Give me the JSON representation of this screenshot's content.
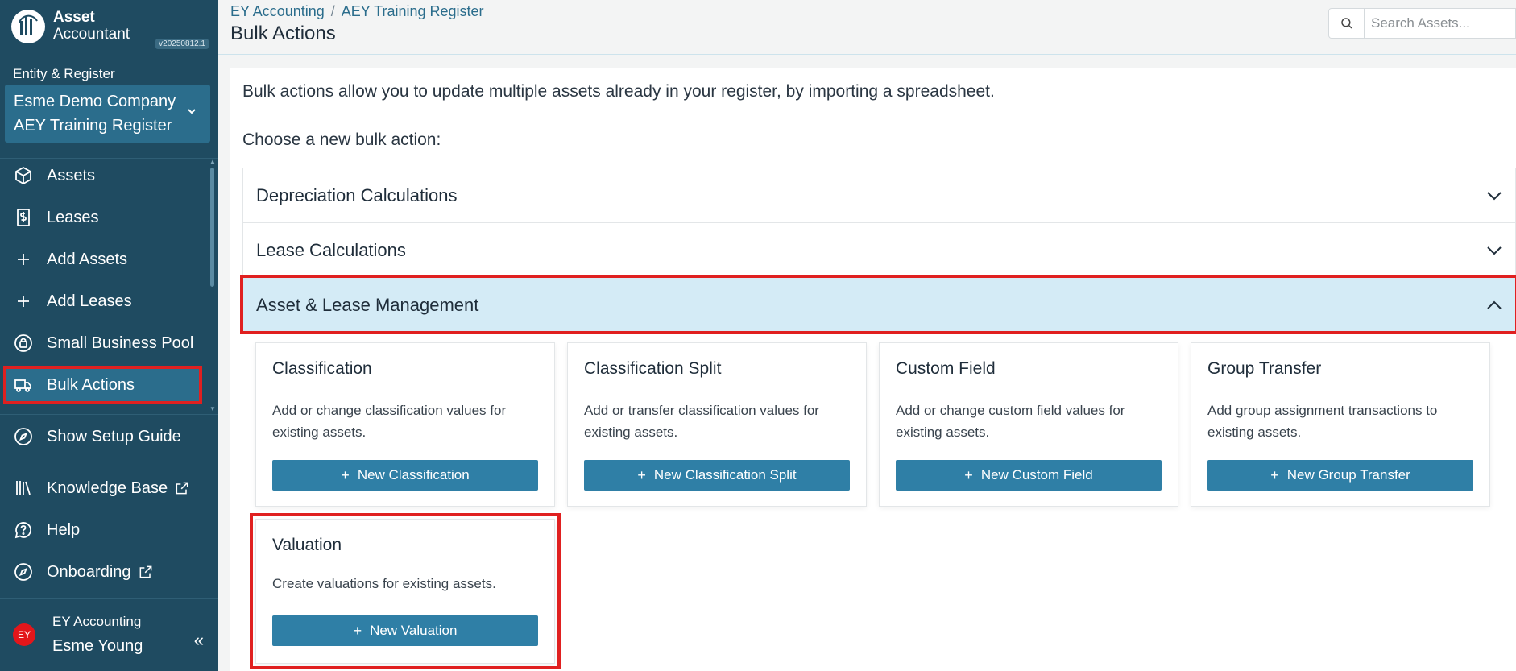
{
  "app": {
    "logo_title": "Asset",
    "logo_subtitle": "Accountant",
    "version": "v20250812.1"
  },
  "entity": {
    "label": "Entity & Register",
    "company": "Esme Demo Company",
    "register": "AEY Training Register"
  },
  "nav": {
    "assets": "Assets",
    "leases": "Leases",
    "add_assets": "Add Assets",
    "add_leases": "Add Leases",
    "small_business_pool": "Small Business Pool",
    "bulk_actions": "Bulk Actions",
    "show_setup_guide": "Show Setup Guide",
    "knowledge_base": "Knowledge Base",
    "help": "Help",
    "onboarding": "Onboarding"
  },
  "user": {
    "initials": "EY",
    "org": "EY Accounting",
    "name": "Esme Young",
    "collapse": "«"
  },
  "breadcrumb": {
    "first": "EY Accounting",
    "separator": "/",
    "second": "AEY Training Register"
  },
  "page": {
    "title": "Bulk Actions",
    "intro": "Bulk actions allow you to update multiple assets already in your register, by importing a spreadsheet.",
    "choose": "Choose a new bulk action:"
  },
  "search": {
    "placeholder": "Search Assets..."
  },
  "accordion": [
    {
      "label": "Depreciation Calculations",
      "expanded": false
    },
    {
      "label": "Lease Calculations",
      "expanded": false
    },
    {
      "label": "Asset & Lease Management",
      "expanded": true
    }
  ],
  "cards": [
    {
      "title": "Classification",
      "description": "Add or change classification values for existing assets.",
      "button": "New Classification"
    },
    {
      "title": "Classification Split",
      "description": "Add or transfer classification values for existing assets.",
      "button": "New Classification Split"
    },
    {
      "title": "Custom Field",
      "description": "Add or change custom field values for existing assets.",
      "button": "New Custom Field"
    },
    {
      "title": "Group Transfer",
      "description": "Add group assignment transactions to existing assets.",
      "button": "New Group Transfer"
    },
    {
      "title": "Valuation",
      "description": "Create valuations for existing assets.",
      "button": "New Valuation"
    }
  ],
  "colors": {
    "sidebar": "#1f4b61",
    "accent": "#2f7fa6",
    "highlight": "#e02020",
    "expanded_bg": "#d4ebf6"
  }
}
